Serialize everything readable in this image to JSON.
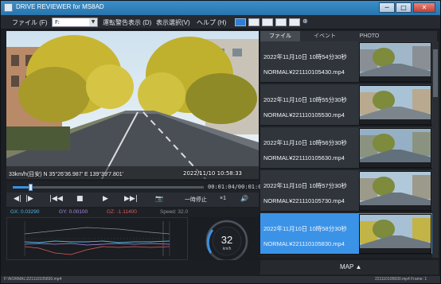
{
  "window": {
    "title": "DRIVE REVIEWER for MS8AD",
    "minimize": "─",
    "maximize": "□",
    "close": "✕"
  },
  "menu": {
    "file": "ファイル (F)",
    "file_select_value": "F:",
    "warning_display": "運転警告表示 (D)",
    "display_select": "表示選択(V)",
    "help": "ヘルプ (H)"
  },
  "video": {
    "overlay_info": "33km/h(目安)  N 35°26'36.987' E 139°39'7.801'",
    "overlay_time": "2022/11/10 10:58:33"
  },
  "seek": {
    "time": "00:01:04/00:01:01",
    "progress_fraction": 0.09
  },
  "controls": {
    "frame_back": "◀|",
    "frame_forward": "|▶",
    "skip_back": "|◀◀",
    "stop": "■",
    "play": "▶",
    "skip_forward": "▶▶|",
    "snapshot": "📷",
    "pause_label": "一時停止",
    "speed_label": "×1",
    "volume": "🔊"
  },
  "sensor": {
    "gx": "GX: 0.03290",
    "gy": "GY: 0.00100",
    "gz": "GZ: -1.11400",
    "speed": "Speed: 32.0",
    "gauge_value": "32",
    "gauge_unit": "km/h",
    "colors": {
      "gx": "#4fb3e8",
      "gy": "#a98be6",
      "gz": "#e05a5a",
      "speed": "#8d949c"
    }
  },
  "right_tabs": {
    "file": "ファイル",
    "event": "イベント",
    "photo": "PHOTO"
  },
  "files": [
    {
      "datetime": "2022年11月10日  10時54分30秒",
      "filename": "NORMAL¥221110105430.mp4",
      "selected": false
    },
    {
      "datetime": "2022年11月10日  10時55分30秒",
      "filename": "NORMAL¥221110105530.mp4",
      "selected": false
    },
    {
      "datetime": "2022年11月10日  10時56分30秒",
      "filename": "NORMAL¥221110105630.mp4",
      "selected": false
    },
    {
      "datetime": "2022年11月10日  10時57分30秒",
      "filename": "NORMAL¥221110105730.mp4",
      "selected": false
    },
    {
      "datetime": "2022年11月10日  10時58分30秒",
      "filename": "NORMAL¥221110105830.mp4",
      "selected": true
    }
  ],
  "map_button": "MAP",
  "status": {
    "left": "F:\\NORMAL\\221110105830.mp4",
    "right": "221110105830.mp4  Frame: 1"
  }
}
